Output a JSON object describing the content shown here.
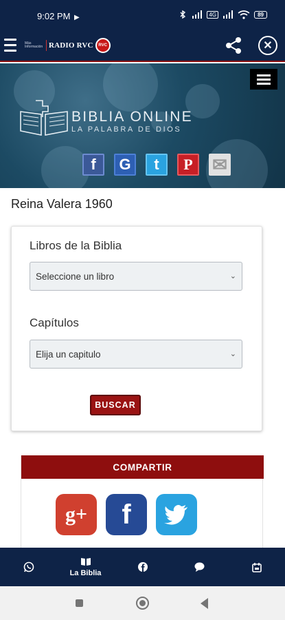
{
  "status_bar": {
    "time": "9:02 PM",
    "play_glyph": "▶",
    "icons": [
      "bluetooth-icon",
      "signal-icon",
      "volte-icon",
      "signal-icon",
      "wifi-icon",
      "battery-icon"
    ],
    "volte_text": "4G",
    "battery_text": "89"
  },
  "app_bar": {
    "brand_small": "Más Información",
    "brand_name": "RADIO RVC",
    "brand_badge": "RVC",
    "close_glyph": "✕"
  },
  "hero": {
    "title": "BIBLIA ONLINE",
    "subtitle": "LA PALABRA DE DIOS",
    "social": [
      {
        "name": "facebook",
        "glyph": "f",
        "color": "#3b5998"
      },
      {
        "name": "google",
        "glyph": "G",
        "color": "#2d5fb3"
      },
      {
        "name": "twitter",
        "glyph": "t",
        "color": "#2aa3e0"
      },
      {
        "name": "pinterest",
        "glyph": "P",
        "color": "#c71f26"
      },
      {
        "name": "email",
        "glyph": "✉",
        "color": "#d8d8d8"
      }
    ]
  },
  "version_title": "Reina Valera 1960",
  "form": {
    "books_label": "Libros de la Biblia",
    "books_value": "Seleccione un libro",
    "chapters_label": "Capítulos",
    "chapters_value": "Elija un capitulo",
    "search_button": "BUSCAR",
    "chevron": "⌄"
  },
  "share": {
    "header": "COMPARTIR",
    "icons": [
      {
        "name": "google-plus",
        "glyph": "g+",
        "color": "#d0402f"
      },
      {
        "name": "facebook",
        "glyph": "f",
        "color": "#264a95"
      },
      {
        "name": "twitter",
        "glyph": "🐦",
        "color": "#2aa3e0"
      }
    ]
  },
  "bottom_nav": [
    {
      "name": "whatsapp",
      "label": ""
    },
    {
      "name": "bible",
      "label": "La Biblia"
    },
    {
      "name": "facebook",
      "label": ""
    },
    {
      "name": "chat",
      "label": ""
    },
    {
      "name": "calendar",
      "label": ""
    }
  ]
}
